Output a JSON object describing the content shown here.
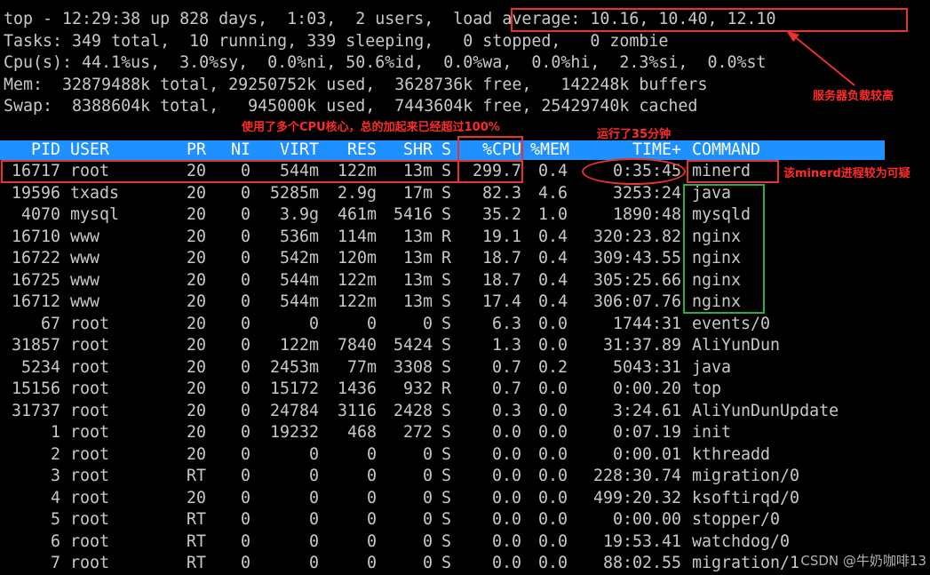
{
  "summary": [
    "top - 12:29:38 up 828 days,  1:03,  2 users,  load average: 10.16, 10.40, 12.10",
    "Tasks: 349 total,  10 running, 339 sleeping,   0 stopped,   0 zombie",
    "Cpu(s): 44.1%us,  3.0%sy,  0.0%ni, 50.6%id,  0.0%wa,  0.0%hi,  2.3%si,  0.0%st",
    "Mem:  32879488k total, 29250752k used,  3628736k free,   142248k buffers",
    "Swap:  8388604k total,   945000k used,  7443604k free, 25429740k cached"
  ],
  "columns": [
    "PID",
    "USER",
    "PR",
    "NI",
    "VIRT",
    "RES",
    "SHR",
    "S",
    "%CPU",
    "%MEM",
    "TIME+",
    "COMMAND"
  ],
  "processes": [
    [
      "16717",
      "root",
      "20",
      "0",
      "544m",
      "122m",
      "13m",
      "S",
      "299.7",
      "0.4",
      "0:35:45",
      "minerd"
    ],
    [
      "19596",
      "txads",
      "20",
      "0",
      "5285m",
      "2.9g",
      "17m",
      "S",
      "82.3",
      "4.6",
      "3253:24",
      "java"
    ],
    [
      "4070",
      "mysql",
      "20",
      "0",
      "3.9g",
      "461m",
      "5416",
      "S",
      "35.2",
      "1.0",
      "1890:48",
      "mysqld"
    ],
    [
      "16710",
      "www",
      "20",
      "0",
      "536m",
      "114m",
      "13m",
      "R",
      "19.1",
      "0.4",
      "320:23.82",
      "nginx"
    ],
    [
      "16722",
      "www",
      "20",
      "0",
      "542m",
      "120m",
      "13m",
      "R",
      "18.7",
      "0.4",
      "309:43.55",
      "nginx"
    ],
    [
      "16725",
      "www",
      "20",
      "0",
      "544m",
      "122m",
      "13m",
      "S",
      "18.7",
      "0.4",
      "305:25.66",
      "nginx"
    ],
    [
      "16712",
      "www",
      "20",
      "0",
      "544m",
      "122m",
      "13m",
      "S",
      "17.4",
      "0.4",
      "306:07.76",
      "nginx"
    ],
    [
      "67",
      "root",
      "20",
      "0",
      "0",
      "0",
      "0",
      "S",
      "6.3",
      "0.0",
      "1744:31",
      "events/0"
    ],
    [
      "31857",
      "root",
      "20",
      "0",
      "122m",
      "7840",
      "5424",
      "S",
      "1.3",
      "0.0",
      "31:37.89",
      "AliYunDun"
    ],
    [
      "5234",
      "root",
      "20",
      "0",
      "2453m",
      "77m",
      "3308",
      "S",
      "0.7",
      "0.2",
      "5043:31",
      "java"
    ],
    [
      "15156",
      "root",
      "20",
      "0",
      "15172",
      "1436",
      "932",
      "R",
      "0.7",
      "0.0",
      "0:00.20",
      "top"
    ],
    [
      "31737",
      "root",
      "20",
      "0",
      "24784",
      "3116",
      "2428",
      "S",
      "0.3",
      "0.0",
      "3:24.61",
      "AliYunDunUpdate"
    ],
    [
      "1",
      "root",
      "20",
      "0",
      "19232",
      "468",
      "272",
      "S",
      "0.0",
      "0.0",
      "0:07.19",
      "init"
    ],
    [
      "2",
      "root",
      "20",
      "0",
      "0",
      "0",
      "0",
      "S",
      "0.0",
      "0.0",
      "0:00.01",
      "kthreadd"
    ],
    [
      "3",
      "root",
      "RT",
      "0",
      "0",
      "0",
      "0",
      "S",
      "0.0",
      "0.0",
      "228:30.74",
      "migration/0"
    ],
    [
      "4",
      "root",
      "20",
      "0",
      "0",
      "0",
      "0",
      "S",
      "0.0",
      "0.0",
      "499:20.32",
      "ksoftirqd/0"
    ],
    [
      "5",
      "root",
      "RT",
      "0",
      "0",
      "0",
      "0",
      "S",
      "0.0",
      "0.0",
      "0:00.00",
      "stopper/0"
    ],
    [
      "6",
      "root",
      "RT",
      "0",
      "0",
      "0",
      "0",
      "S",
      "0.0",
      "0.0",
      "19:53.41",
      "watchdog/0"
    ],
    [
      "7",
      "root",
      "RT",
      "0",
      "0",
      "0",
      "0",
      "S",
      "0.0",
      "0.0",
      "88:02.55",
      "migration/1"
    ]
  ],
  "annotations": {
    "server_load": "服务器负载较高",
    "multi_core": "使用了多个CPU核心，总的加起来已经超过100%",
    "run_time": "运行了35分钟",
    "suspicious": "该minerd进程较为可疑"
  },
  "watermark": "CSDN @牛奶咖啡13",
  "colors": {
    "background": "#000000",
    "text": "#c8c8c8",
    "header_bar": "#1e90ff",
    "annotation_red": "#e8322c",
    "highlight_green": "#2fa84a"
  }
}
